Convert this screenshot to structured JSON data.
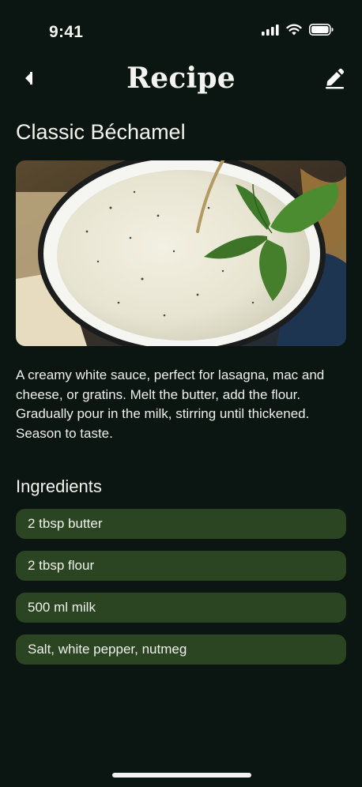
{
  "status_bar": {
    "time": "9:41",
    "icons": [
      "cellular-signal-icon",
      "wifi-icon",
      "battery-icon"
    ]
  },
  "nav": {
    "back_icon": "back-arrow-icon",
    "title": "Recipe",
    "edit_icon": "edit-pencil-icon"
  },
  "recipe": {
    "name": "Classic Béchamel",
    "image": "bowl of béchamel sauce with basil leaves",
    "description": "A creamy white sauce, perfect for lasagna, mac and cheese, or gratins. Melt the butter, add the flour. Gradually pour in the milk, stirring until thickened. Season to taste."
  },
  "ingredients": {
    "title": "Ingredients",
    "items": [
      "2 tbsp butter",
      "2 tbsp flour",
      "500 ml milk",
      "Salt, white pepper, nutmeg"
    ]
  },
  "colors": {
    "background": "#0b1512",
    "ingredient_pill": "#2b4522",
    "text": "#f3f4f1"
  }
}
